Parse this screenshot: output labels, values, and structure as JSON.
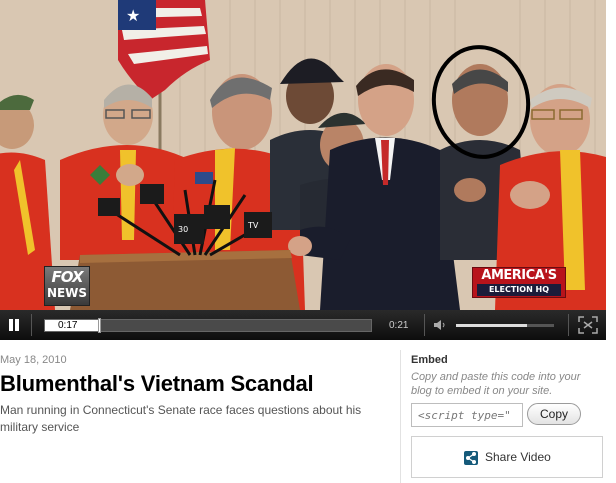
{
  "player": {
    "logo_left_line1": "FOX",
    "logo_left_line2": "NEWS",
    "logo_right_line1": "AMERICA'S",
    "logo_right_line2": "ELECTION HQ",
    "current_time": "0:17",
    "duration": "0:21",
    "progress_fraction": 0.17,
    "volume_fraction": 0.72,
    "icons": {
      "play_pause": "pause-icon",
      "volume": "volume-icon",
      "fullscreen": "fullscreen-icon"
    }
  },
  "article": {
    "date": "May 18, 2010",
    "title": "Blumenthal's Vietnam Scandal",
    "description": "Man running in Connecticut's Senate race faces questions about his military service"
  },
  "embed": {
    "heading": "Embed",
    "instructions": "Copy and paste this code into your blog to embed it on your site.",
    "code_value": "<script type=\"",
    "copy_label": "Copy",
    "share_label": "Share Video",
    "share_icon": "share-icon"
  },
  "colors": {
    "jacket_red": "#d8311f",
    "fox_red": "#b8131b",
    "share_blue": "#155a7a"
  }
}
